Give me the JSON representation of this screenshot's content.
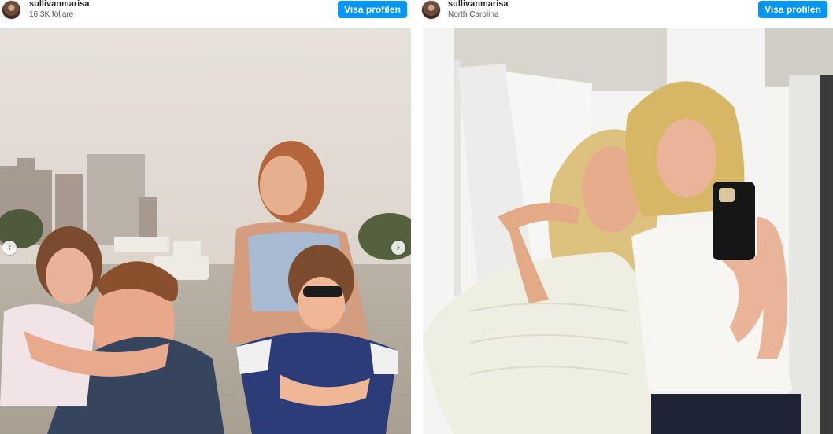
{
  "posts": [
    {
      "username": "sullivanmarisa",
      "subtitle": "16.3K följare",
      "button_label": "Visa profilen",
      "photo_description_icon": "vintage-family-photo",
      "nav_prev_icon": "‹",
      "nav_next_icon": "›"
    },
    {
      "username": "sullivanmarisa",
      "subtitle": "North Carolina",
      "button_label": "Visa profilen",
      "photo_description_icon": "mirror-selfie-photo"
    }
  ],
  "colors": {
    "button_blue": "#0095f6",
    "username_text": "#262626"
  }
}
